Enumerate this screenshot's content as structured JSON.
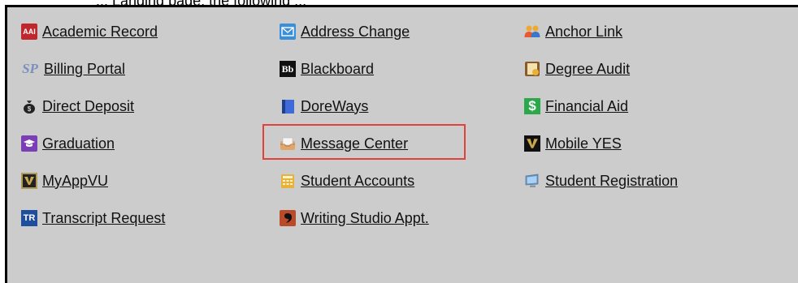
{
  "header": {
    "partial_text": "... Landing page, the following ..."
  },
  "links": [
    {
      "label": "Academic Record",
      "icon": "academic-record-icon",
      "icon_text": "AAI"
    },
    {
      "label": "Billing Portal",
      "icon": "billing-portal-icon",
      "icon_text": "SP"
    },
    {
      "label": "Direct Deposit",
      "icon": "money-bag-icon"
    },
    {
      "label": "Graduation",
      "icon": "graduation-cap-icon"
    },
    {
      "label": "MyAppVU",
      "icon": "vanderbilt-v-icon"
    },
    {
      "label": "Transcript Request",
      "icon": "transcript-request-icon",
      "icon_text": "TR"
    },
    {
      "label": "Address Change",
      "icon": "envelope-icon"
    },
    {
      "label": "Blackboard",
      "icon": "blackboard-icon",
      "icon_text": "Bb"
    },
    {
      "label": "DoreWays",
      "icon": "doreways-book-icon"
    },
    {
      "label": "Message Center",
      "icon": "message-center-inbox-icon"
    },
    {
      "label": "Student Accounts",
      "icon": "calculator-icon"
    },
    {
      "label": "Writing Studio Appt.",
      "icon": "writing-studio-icon"
    },
    {
      "label": "Anchor Link",
      "icon": "people-icon"
    },
    {
      "label": "Degree Audit",
      "icon": "degree-audit-icon"
    },
    {
      "label": "Financial Aid",
      "icon": "dollar-sign-icon",
      "icon_text": "$"
    },
    {
      "label": "Mobile YES",
      "icon": "vanderbilt-v-icon"
    },
    {
      "label": "Student Registration",
      "icon": "computer-monitor-icon"
    }
  ],
  "highlight": {
    "target": "Message Center",
    "color": "#e0413c"
  }
}
